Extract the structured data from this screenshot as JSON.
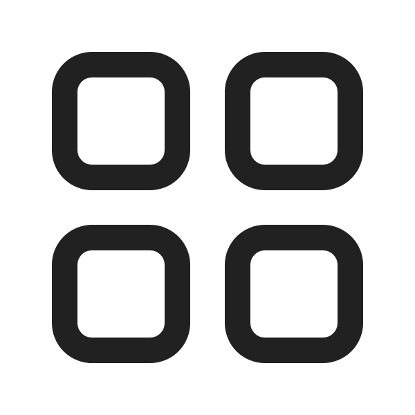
{
  "icon": {
    "name": "grid-icon",
    "stroke_color": "#212121",
    "background_color": "#ffffff"
  }
}
